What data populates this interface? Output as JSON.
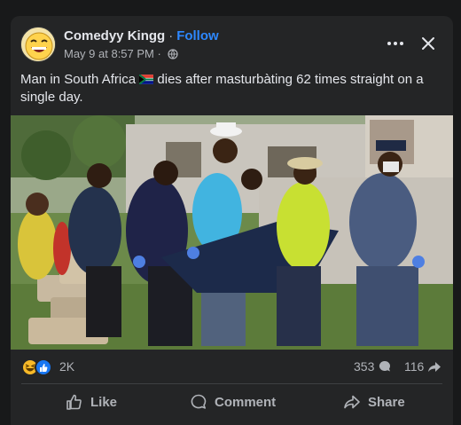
{
  "post": {
    "author": "Comedyy Kingg",
    "separator": "·",
    "follow_label": "Follow",
    "timestamp": "May 9 at 8:57 PM ·",
    "caption_before_flag": "Man in South Africa ",
    "caption_after_flag": " dies after masturbàting 62 times straight on a single day.",
    "privacy_icon": "globe-icon",
    "flag_icon": "south-africa-flag-icon"
  },
  "stats": {
    "reactions_count": "2K",
    "reaction_icons": [
      "haha-reaction-icon",
      "like-reaction-icon"
    ],
    "comments_count": "353",
    "shares_count": "116"
  },
  "actions": {
    "like_label": "Like",
    "comment_label": "Comment",
    "share_label": "Share"
  },
  "colors": {
    "background": "#18191a",
    "card": "#242526",
    "text_primary": "#e4e6eb",
    "text_secondary": "#b0b3b8",
    "link_blue": "#2d88ff",
    "like_blue": "#1877f2",
    "haha_yellow": "#f7b928"
  }
}
